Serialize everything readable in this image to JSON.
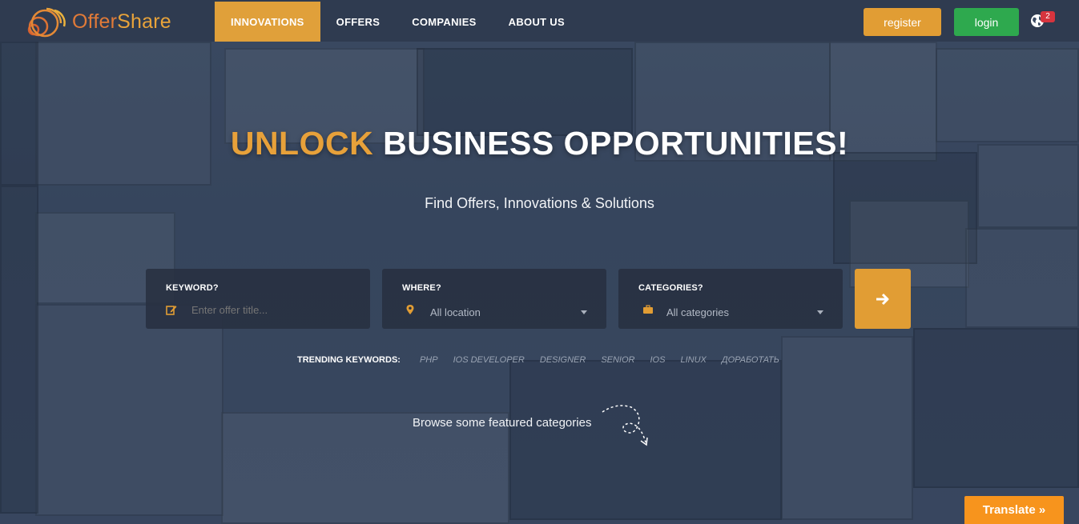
{
  "brand": {
    "name_part1": "Offer",
    "name_part2": "Share"
  },
  "nav": {
    "items": [
      {
        "label": "INNOVATIONS",
        "active": true
      },
      {
        "label": "OFFERS",
        "active": false
      },
      {
        "label": "COMPANIES",
        "active": false
      },
      {
        "label": "ABOUT US",
        "active": false
      }
    ]
  },
  "header": {
    "register_label": "register",
    "login_label": "login",
    "notification_count": "2"
  },
  "hero": {
    "title_highlight": "UNLOCK",
    "title_rest": " BUSINESS OPPORTUNITIES!",
    "subtitle": "Find Offers, Innovations & Solutions"
  },
  "search": {
    "keyword_label": "KEYWORD?",
    "keyword_placeholder": "Enter offer title...",
    "where_label": "WHERE?",
    "where_value": "All location",
    "categories_label": "CATEGORIES?",
    "categories_value": "All categories",
    "submit_icon": "arrow-right-icon"
  },
  "trending": {
    "label": "TRENDING KEYWORDS:",
    "keywords": [
      "PHP",
      "IOS DEVELOPER",
      "DESIGNER",
      "SENIOR",
      "IOS",
      "LINUX",
      "ДОРАБОТАТЬ"
    ]
  },
  "browse_text": "Browse some featured categories",
  "translate_label": "Translate »",
  "colors": {
    "accent": "#e19d34",
    "login": "#2ea94e",
    "badge": "#d7343e",
    "translate": "#f7941d"
  }
}
